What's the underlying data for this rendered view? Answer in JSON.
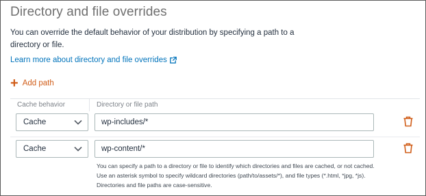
{
  "section": {
    "title": "Directory and file overrides",
    "description": "You can override the default behavior of your distribution by specifying a path to a directory or file.",
    "learn_more": "Learn more about directory and file overrides",
    "add_path": "Add path"
  },
  "table": {
    "headers": {
      "cache_behavior": "Cache behavior",
      "path": "Directory or file path"
    },
    "rows": [
      {
        "cache_behavior": "Cache",
        "path": "wp-includes/*"
      },
      {
        "cache_behavior": "Cache",
        "path": "wp-content/*"
      }
    ]
  },
  "help_text": {
    "line1": "You can specify a path to a directory or file to identify which directories and files are cached, or not cached.",
    "line2": "Use an asterisk symbol to specify wildcard directories (path/to/assets/*), and file types (*.html, *jpg, *js).",
    "line3": "Directories and file paths are case-sensitive."
  },
  "icons": {
    "learn_more": "external-link-icon",
    "add_path": "plus-icon",
    "select": "chevron-down-icon",
    "delete": "trash-icon"
  },
  "colors": {
    "link": "#0073bb",
    "accent_orange": "#d05c17",
    "title_gray": "#6f6f6f"
  }
}
